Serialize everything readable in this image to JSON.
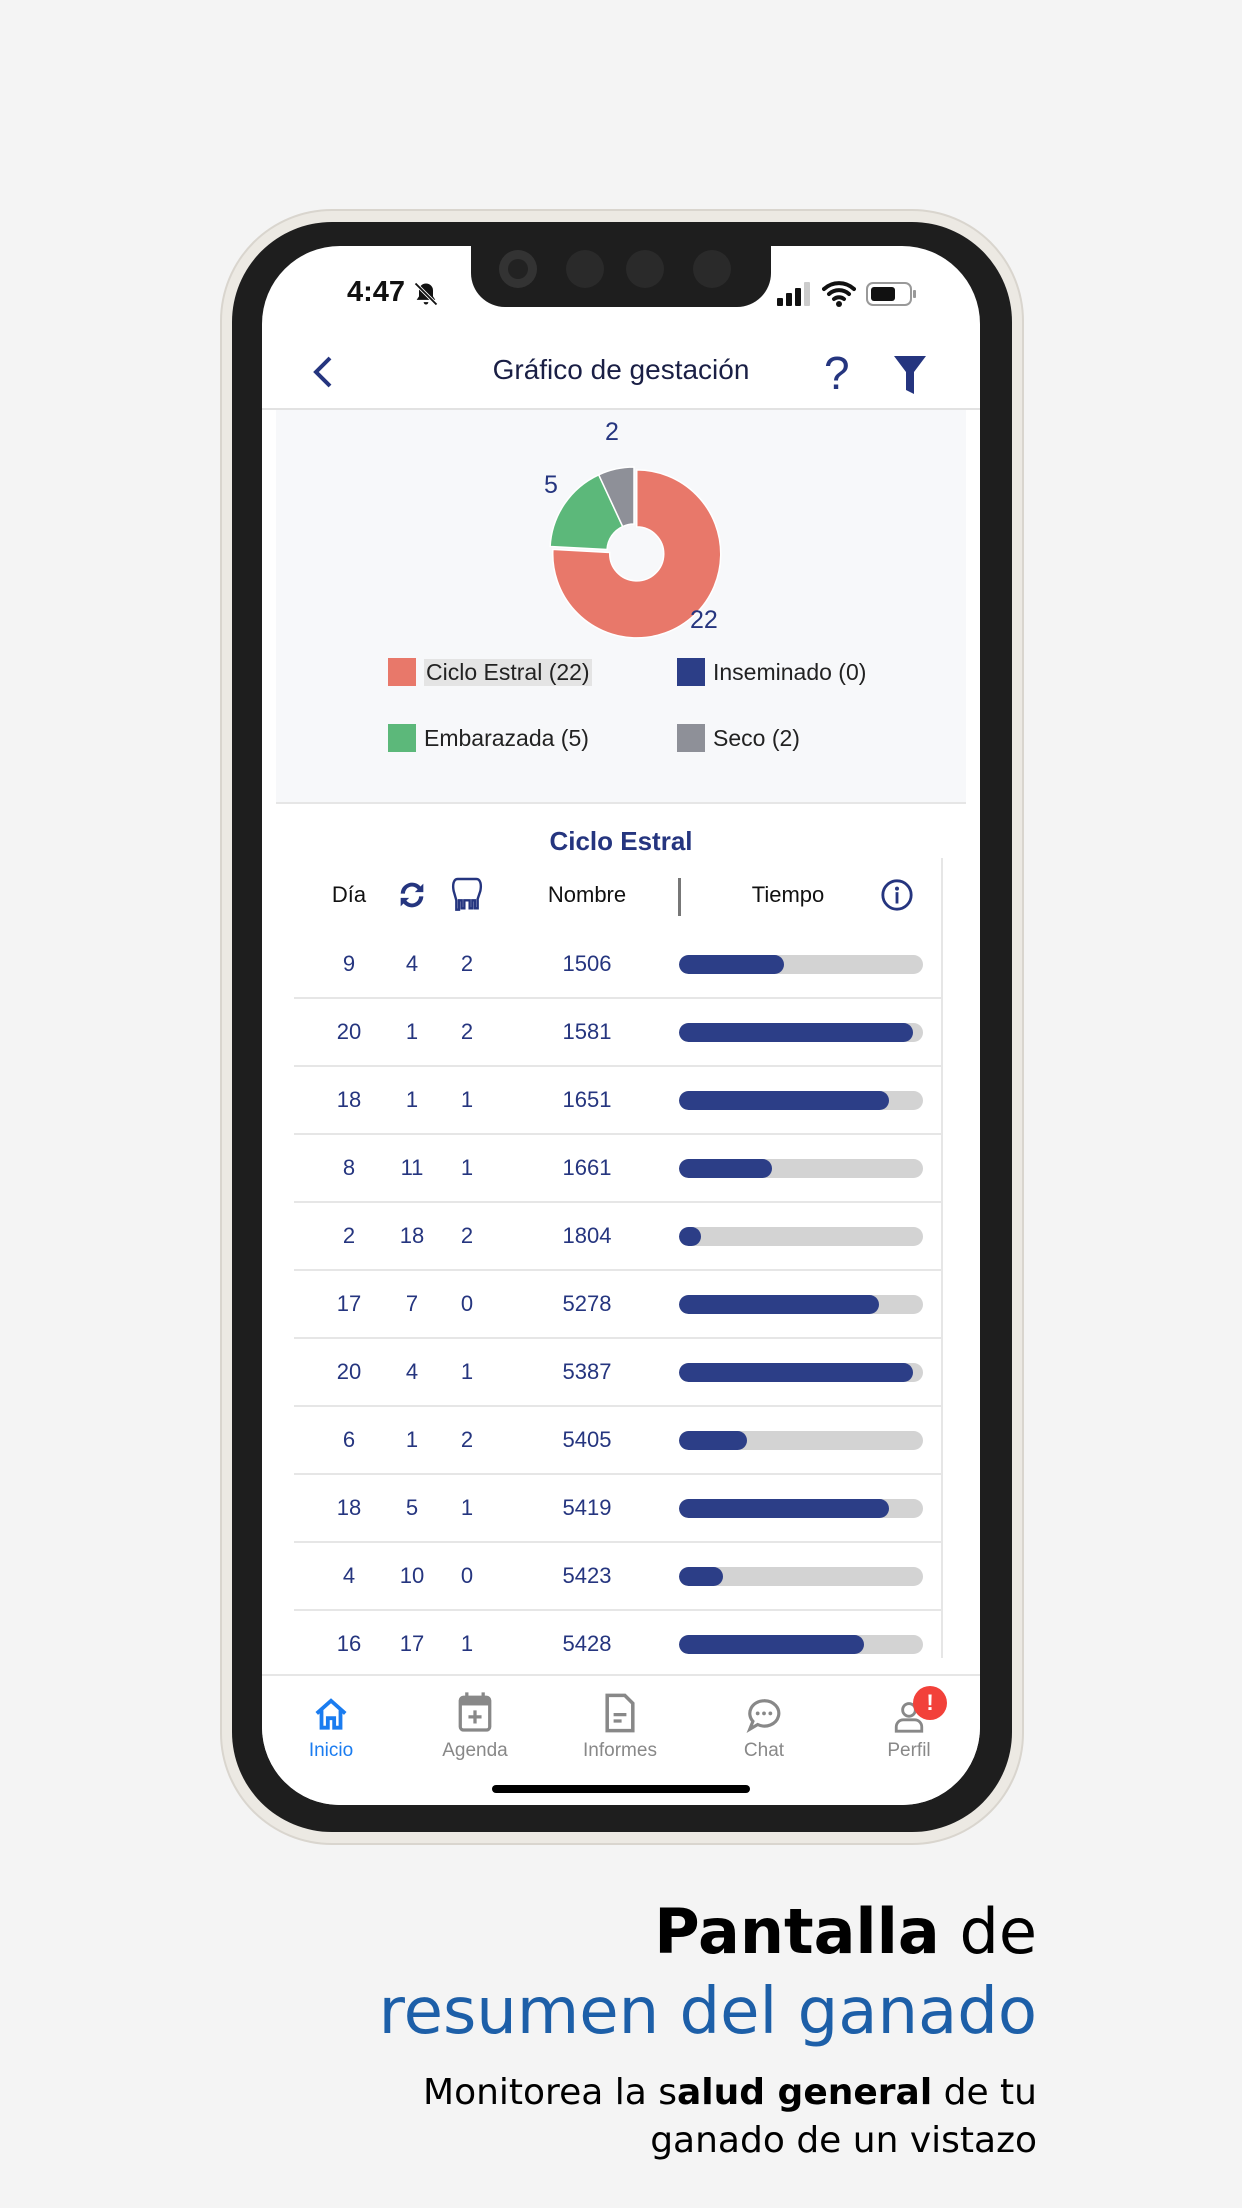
{
  "status_bar": {
    "time": "4:47"
  },
  "header": {
    "title": "Gráfico de gestación",
    "back_icon": "chevron-left-icon",
    "help_icon": "question-icon",
    "filter_icon": "filter-icon"
  },
  "chart_data": {
    "type": "pie",
    "donut": true,
    "slices": [
      {
        "name": "Ciclo Estral",
        "value": 22,
        "color": "#e8786a"
      },
      {
        "name": "Inseminado",
        "value": 0,
        "color": "#2c3e87"
      },
      {
        "name": "Embarazada",
        "value": 5,
        "color": "#5cb87a"
      },
      {
        "name": "Seco",
        "value": 2,
        "color": "#8e9098"
      }
    ],
    "data_labels": [
      "22",
      "5",
      "2"
    ],
    "legend": [
      "Ciclo Estral (22)",
      "Inseminado (0)",
      "Embarazada (5)",
      "Seco (2)"
    ],
    "legend_placement": "bottom"
  },
  "table": {
    "title": "Ciclo Estral",
    "headers": {
      "dia": "Día",
      "cycles_icon": "sync-icon",
      "udder_icon": "udder-icon",
      "nombre": "Nombre",
      "tiempo": "Tiempo",
      "info_icon": "info-icon"
    },
    "rows": [
      {
        "dia": "9",
        "ciclos": "4",
        "partos": "2",
        "nombre": "1506",
        "tiempo": 0.43
      },
      {
        "dia": "20",
        "ciclos": "1",
        "partos": "2",
        "nombre": "1581",
        "tiempo": 0.96
      },
      {
        "dia": "18",
        "ciclos": "1",
        "partos": "1",
        "nombre": "1651",
        "tiempo": 0.86
      },
      {
        "dia": "8",
        "ciclos": "11",
        "partos": "1",
        "nombre": "1661",
        "tiempo": 0.38
      },
      {
        "dia": "2",
        "ciclos": "18",
        "partos": "2",
        "nombre": "1804",
        "tiempo": 0.09
      },
      {
        "dia": "17",
        "ciclos": "7",
        "partos": "0",
        "nombre": "5278",
        "tiempo": 0.82
      },
      {
        "dia": "20",
        "ciclos": "4",
        "partos": "1",
        "nombre": "5387",
        "tiempo": 0.96
      },
      {
        "dia": "6",
        "ciclos": "1",
        "partos": "2",
        "nombre": "5405",
        "tiempo": 0.28
      },
      {
        "dia": "18",
        "ciclos": "5",
        "partos": "1",
        "nombre": "5419",
        "tiempo": 0.86
      },
      {
        "dia": "4",
        "ciclos": "10",
        "partos": "0",
        "nombre": "5423",
        "tiempo": 0.18
      },
      {
        "dia": "16",
        "ciclos": "17",
        "partos": "1",
        "nombre": "5428",
        "tiempo": 0.76
      }
    ]
  },
  "bottom_nav": {
    "active_color": "#1a7cf0",
    "items": [
      {
        "label": "Inicio",
        "icon": "home-icon",
        "active": true
      },
      {
        "label": "Agenda",
        "icon": "calendar-add-icon"
      },
      {
        "label": "Informes",
        "icon": "document-icon"
      },
      {
        "label": "Chat",
        "icon": "chat-bubble-icon"
      },
      {
        "label": "Perfil",
        "icon": "user-icon",
        "badge": "!"
      }
    ]
  },
  "caption": {
    "line1_bold": "Pantalla",
    "line1_rest": " de",
    "line2": "resumen del ganado",
    "line3_a": "Monitorea la s",
    "line3_bold": "alud general",
    "line3_b": " de tu",
    "line4": "ganado de un vistazo",
    "accent_color": "#1d5fa8"
  }
}
